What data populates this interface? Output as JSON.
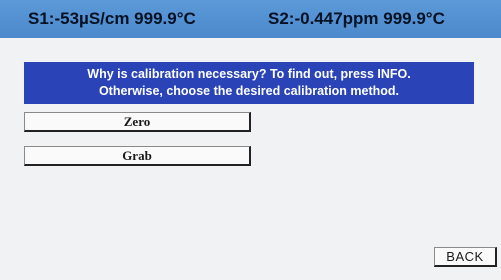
{
  "status_bar": {
    "sensor1": "S1:-53µS/cm 999.9°C",
    "sensor2": "S2:-0.447ppm 999.9°C",
    "background_color": "#4b89cc"
  },
  "info_box": {
    "line1": "Why is calibration necessary? To find out, press INFO.",
    "line2": "Otherwise, choose the desired calibration method.",
    "background_color": "#2a44b8"
  },
  "calibration_methods": [
    {
      "label": "Zero"
    },
    {
      "label": "Grab"
    }
  ],
  "navigation": {
    "back_label": "BACK"
  }
}
